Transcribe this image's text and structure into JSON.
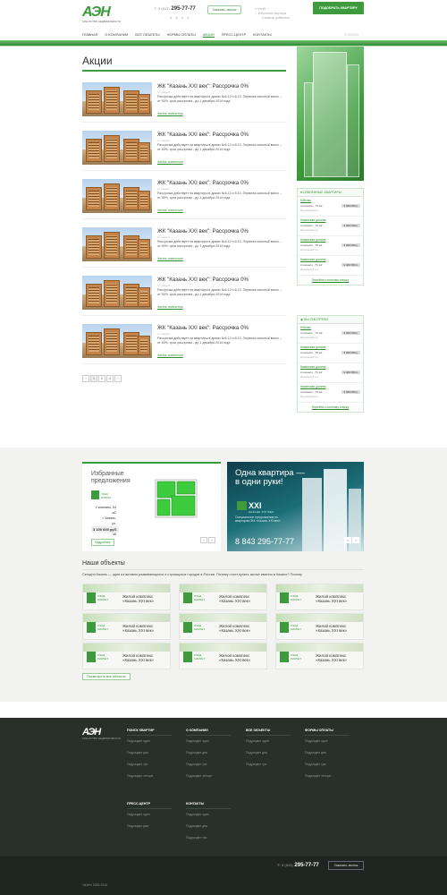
{
  "header": {
    "logo_text": "АЭН",
    "logo_sub": "АГЕНТСТВО НЕДВИЖИМОСТИ",
    "phone_prefix": "8 (843)",
    "phone": "295-77-77",
    "call_button": "Заказать звонок",
    "mail_line1": "info@...",
    "mail_line2": "Избранные квартиры",
    "mail_line3": "0 квартир добавлено",
    "cta_button": "ПОДОБРАТЬ КВАРТИРУ",
    "nav": [
      "ГЛАВНАЯ",
      "О КОМПАНИИ",
      "ВСЕ ОБЪЕКТЫ",
      "ФОРМЫ ОПЛАТЫ",
      "АКЦИИ",
      "ПРЕСС-ЦЕНТР",
      "КОНТАКТЫ"
    ],
    "search_placeholder": "ПОИСК"
  },
  "page": {
    "title": "Акции",
    "read_more": "Читать полностью",
    "promos": [
      {
        "title": "ЖК \"Казань XXI век\": Рассрочка 0%",
        "date": "17 января",
        "text": "Рассрочка действует на квартиры в домах №6.12 и 6.13. Первона-чальный взнос – от 50%, срок рассрочки - до 1 декабря 2014 года"
      },
      {
        "title": "ЖК \"Казань XXI век\": Рассрочка 0%",
        "date": "17 января",
        "text": "Рассрочка действует на квартиры в домах №6.12 и 6.13. Первона-чальный взнос – от 50%, срок рассрочки - до 1 декабря 2014 года"
      },
      {
        "title": "ЖК \"Казань XXI век\": Рассрочка 0%",
        "date": "17 января",
        "text": "Рассрочка действует на квартиры в домах №6.12 и 6.13. Первона-чальный взнос – от 50%, срок рассрочки - до 1 декабря 2014 года"
      },
      {
        "title": "ЖК \"Казань XXI век\": Рассрочка 0%",
        "date": "17 января",
        "text": "Рассрочка действует на квартиры в домах №6.12 и 6.13. Первона-чальный взнос – от 50%, срок рассрочки - до 1 декабря 2014 года"
      },
      {
        "title": "ЖК \"Казань XXI век\": Рассрочка 0%",
        "date": "17 января",
        "text": "Рассрочка действует на квартиры в домах №6.12 и 6.13. Первона-чальный взнос – от 50%, срок рассрочки - до 1 декабря 2014 года"
      },
      {
        "title": "ЖК \"Казань XXI век\": Рассрочка 0%",
        "date": "17 января",
        "text": "Рассрочка действует на квартиры в домах №6.12 и 6.13. Первона-чальный взнос – от 50%, срок рассрочки - до 1 декабря 2014 года"
      }
    ],
    "pagination": [
      "‹",
      "1",
      "2",
      "3",
      "›"
    ]
  },
  "sidebar": {
    "fav_title": "ИЗБРАННЫЕ КВАРТИРЫ",
    "fav_items": [
      {
        "name": "Юбгово",
        "params": "2-комнатн., 76 м2",
        "price": "3 400 000 р.",
        "area": "Московский р-н"
      },
      {
        "name": "Казанская долина",
        "params": "2-комнатн., 76 м2",
        "price": "3 400 000 р.",
        "area": "Московский р-н"
      },
      {
        "name": "Казанская долина",
        "params": "2-комнатн., 76 м2",
        "price": "3 400 000 р.",
        "area": "Московский р-н"
      },
      {
        "name": "Казанская долина",
        "params": "2-комнатн., 76 м2",
        "price": "3 400 000 р.",
        "area": "Московский р-н"
      }
    ],
    "fav_more": "Перейти к полному списку",
    "seen_title": "ВЫ СМОТРЕЛИ",
    "seen_items": [
      {
        "name": "Юбгово",
        "params": "2-комнатн., 76 м2",
        "price": "3 400 000 р.",
        "area": "Московский р-н"
      },
      {
        "name": "Казанская долина",
        "params": "2-комнатн., 76 м2",
        "price": "3 400 000 р.",
        "area": "Московский р-н"
      },
      {
        "name": "Казанская долина",
        "params": "2-комнатн., 76 м2",
        "price": "3 400 000 р.",
        "area": "Московский р-н"
      },
      {
        "name": "Казанская долина",
        "params": "2-комнатн., 76 м2",
        "price": "3 400 000 р.",
        "area": "Московский р-н"
      }
    ],
    "seen_more": "Перейти к полному списку"
  },
  "offer": {
    "heading1": "Избранные",
    "heading2": "предложения",
    "brand": "ЛЭНД МАРКЕТ",
    "line1": "2 комнаты, 54 м2",
    "line2": "г. Казань,",
    "line3": "ул. Коломенитов, 46",
    "price": "3 100 600 руб.",
    "more": "Подробнее"
  },
  "banner": {
    "line1": "Одна квартира —",
    "line2": "в одни руки!",
    "brand": "XXI",
    "brand_sub": "КАЗАНЬ XXI ВЕК",
    "desc": "Специальное предложение по квартирам ЖК «Казань XXI век»",
    "phone": "8 843 295-77-77"
  },
  "objects": {
    "title": "Наши объекты",
    "desc": "Сегодня Казань — один из активно развивающихся и строящихся городов в России. Почему стоит купить жилье именно в Казани? Почему",
    "brand_line1": "ЛЭНД",
    "brand_line2": "МАРКЕТ",
    "tile_line1": "Жилой комплекс",
    "tile_line2": "«Казань XXI век»",
    "all_button": "Посмотреть все объекты"
  },
  "footer": {
    "logo": "АЭН",
    "logo_sub": "АГЕНТСТВО НЕДВИЖИМОСТИ",
    "col1_title": "ПОИСК КВАРТИР",
    "col1_items": [
      "Подраздел один",
      "Подраздел два",
      "Подраздел три",
      "Подраздел четыре"
    ],
    "col2_title": "О КОМПАНИИ",
    "col2_items": [
      "Подраздел один",
      "Подраздел два",
      "Подраздел три",
      "Подраздел четыре"
    ],
    "col3_title": "ВСЕ ОБЪЕКТЫ",
    "col3_items": [
      "Подраздел один",
      "Подраздел два",
      "Подраздел три"
    ],
    "col4_title": "ФОРМЫ ОПЛАТЫ",
    "col4_items": [
      "Подраздел один",
      "Подраздел два",
      "Подраздел три",
      "Подраздел четыре"
    ],
    "col5_title": "ПРЕСС-ЦЕНТР",
    "col5_items": [
      "Подраздел один",
      "Подраздел два"
    ],
    "col6_title": "КОНТАКТЫ",
    "col6_items": [
      "Подраздел один",
      "Подраздел два",
      "Подраздел три"
    ],
    "phone_prefix": "8 (843)",
    "phone": "295-77-77",
    "call_button": "Заказать звонок",
    "copyright": "«АЭН» 2009-2014"
  }
}
